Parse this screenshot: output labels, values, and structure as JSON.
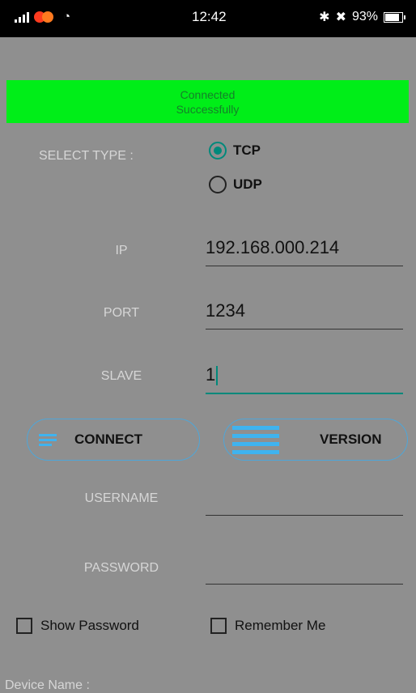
{
  "status_bar": {
    "time": "12:42",
    "battery": "93%",
    "bluetooth_icon": "bluetooth-icon",
    "mute_icon": "mute-icon",
    "signal_icon": "signal-icon",
    "wifi_icon": "wifi-icon"
  },
  "banner": {
    "line1": "Connected",
    "line2": "Successfully",
    "color": "#00ee18"
  },
  "select_type": {
    "label": "SELECT TYPE :",
    "options": [
      {
        "label": "TCP",
        "checked": true
      },
      {
        "label": "UDP",
        "checked": false
      }
    ]
  },
  "fields": {
    "ip": {
      "label": "IP",
      "value": "192.168.000.214"
    },
    "port": {
      "label": "PORT",
      "value": "1234"
    },
    "slave": {
      "label": "SLAVE",
      "value": "1"
    },
    "username": {
      "label": "USERNAME",
      "value": ""
    },
    "password": {
      "label": "PASSWORD",
      "value": ""
    }
  },
  "buttons": {
    "connect": "CONNECT",
    "version": "VERSION"
  },
  "checkboxes": {
    "show_password": "Show Password",
    "remember_me": "Remember Me"
  },
  "device_name_label": "Device Name :"
}
